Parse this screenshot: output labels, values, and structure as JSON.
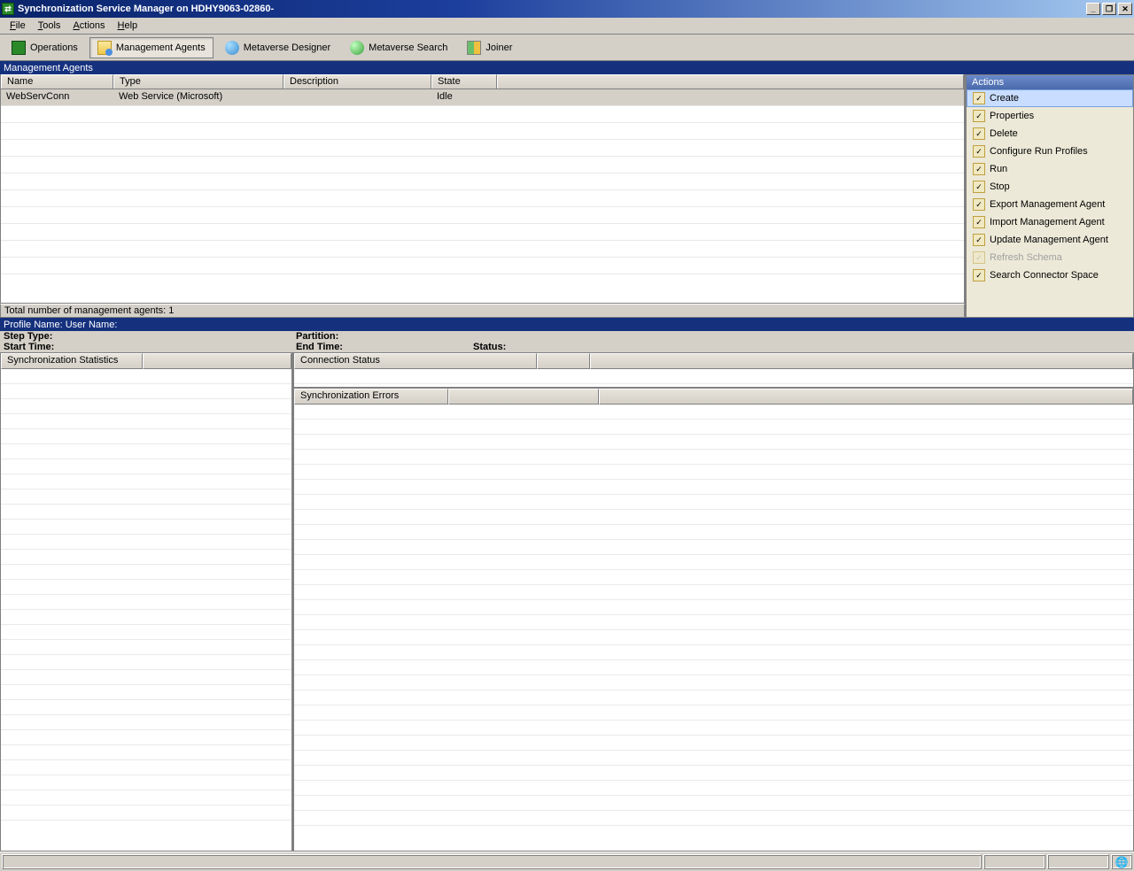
{
  "window": {
    "title": "Synchronization Service Manager on HDHY9063-02860-"
  },
  "menu": {
    "file": "File",
    "tools": "Tools",
    "actions": "Actions",
    "help": "Help"
  },
  "toolbar": {
    "operations": "Operations",
    "management_agents": "Management Agents",
    "metaverse_designer": "Metaverse Designer",
    "metaverse_search": "Metaverse Search",
    "joiner": "Joiner"
  },
  "section": {
    "management_agents": "Management Agents"
  },
  "agents_table": {
    "cols": {
      "name": "Name",
      "type": "Type",
      "description": "Description",
      "state": "State"
    },
    "rows": [
      {
        "name": "WebServConn",
        "type": "Web Service (Microsoft)",
        "description": "",
        "state": "Idle"
      }
    ],
    "footer": "Total number of management agents: 1"
  },
  "actions": {
    "header": "Actions",
    "items": [
      {
        "label": "Create",
        "selected": true,
        "disabled": false
      },
      {
        "label": "Properties",
        "selected": false,
        "disabled": false
      },
      {
        "label": "Delete",
        "selected": false,
        "disabled": false
      },
      {
        "label": "Configure Run Profiles",
        "selected": false,
        "disabled": false
      },
      {
        "label": "Run",
        "selected": false,
        "disabled": false
      },
      {
        "label": "Stop",
        "selected": false,
        "disabled": false
      },
      {
        "label": "Export Management Agent",
        "selected": false,
        "disabled": false
      },
      {
        "label": "Import Management Agent",
        "selected": false,
        "disabled": false
      },
      {
        "label": "Update Management Agent",
        "selected": false,
        "disabled": false
      },
      {
        "label": "Refresh Schema",
        "selected": false,
        "disabled": true
      },
      {
        "label": "Search Connector Space",
        "selected": false,
        "disabled": false
      }
    ]
  },
  "profile": {
    "header": "Profile Name:   User Name:",
    "step_type_label": "Step Type:",
    "start_time_label": "Start Time:",
    "partition_label": "Partition:",
    "end_time_label": "End Time:",
    "status_label": "Status:"
  },
  "panels": {
    "sync_stats": "Synchronization Statistics",
    "conn_status": "Connection Status",
    "sync_errors": "Synchronization Errors"
  }
}
